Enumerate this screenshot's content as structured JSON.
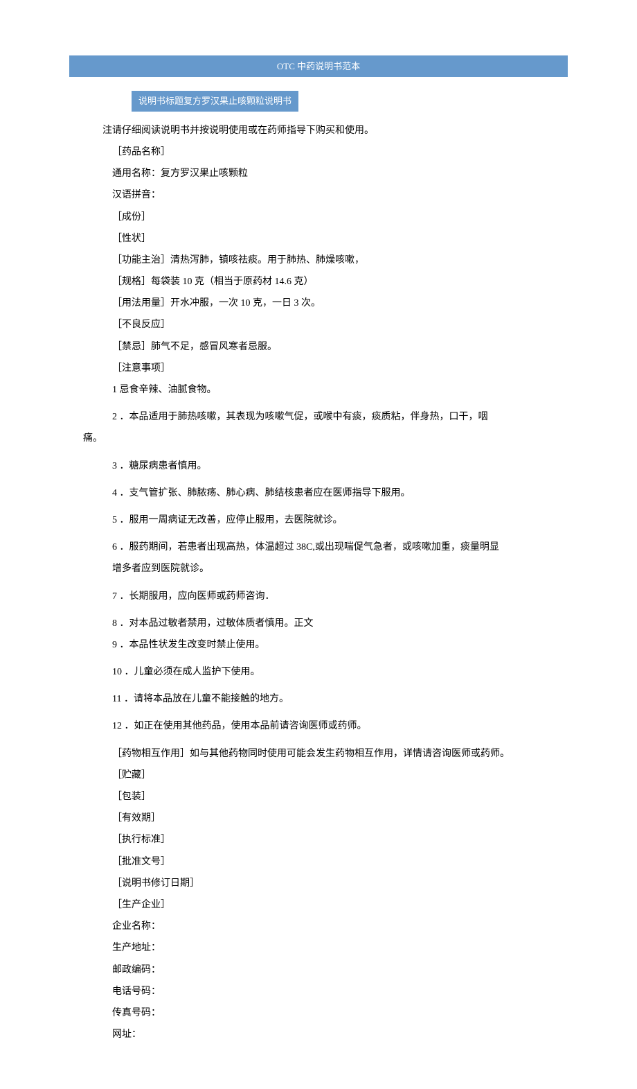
{
  "header": {
    "title": "OTC 中药说明书范本"
  },
  "subtitle": "说明书标题复方罗汉果止咳颗粒说明书",
  "intro": "注请仔细阅读说明书并按说明使用或在药师指导下购买和使用。",
  "fields": {
    "drug_name_label": "［药品名称］",
    "generic_name": "通用名称：复方罗汉果止咳颗粒",
    "pinyin": "汉语拼音：",
    "ingredients": "［成份］",
    "properties": "［性状］",
    "functions": "［功能主治］清热泻肺，镇咳祛痰。用于肺热、肺燥咳嗽，",
    "spec": "［规格］每袋装 10 克（相当于原药材 14.6 克）",
    "usage": "［用法用量］开水冲服，一次 10 克，一日 3 次。",
    "adverse": "［不良反应］",
    "contraindications": "［禁忌］肺气不足，感冒风寒者忌服。",
    "precautions_label": "［注意事项］"
  },
  "precautions": {
    "p1": "1 忌食辛辣、油腻食物。",
    "p2": "2 ．本品适用于肺热咳嗽，其表现为咳嗽气促，或喉中有痰，痰质粘，伴身热，口干，咽",
    "p2_cont": "痛。",
    "p3": "3 ．糖尿病患者慎用。",
    "p4": "4 ．支气管扩张、肺脓疡、肺心病、肺结核患者应在医师指导下服用。",
    "p5": "5 ．服用一周病证无改善，应停止服用，去医院就诊。",
    "p6": "6 ．服药期间，若患者出现高热，体温超过 38C,或出现喘促气急者，或咳嗽加重，痰量明显",
    "p6_cont": "增多者应到医院就诊。",
    "p7": "7 ．长期服用，应向医师或药师咨询．",
    "p8": "8 ．对本品过敏者禁用，过敏体质者慎用。正文",
    "p9": "9 ．本品性状发生改变时禁止使用。",
    "p10": "10 ．儿童必须在成人监护下使用。",
    "p11": "11 ．请将本品放在儿童不能接触的地方。",
    "p12": "12 ．如正在使用其他药品，使用本品前请咨询医师或药师。"
  },
  "footer_fields": {
    "interaction": "［药物相互作用］如与其他药物同时使用可能会发生药物相互作用，详情请咨询医师或药师。",
    "storage": "［贮藏］",
    "packaging": "［包装］",
    "validity": "［有效期］",
    "standard": "［执行标准］",
    "approval": "［批准文号］",
    "revision": "［说明书修订日期］",
    "manufacturer": "［生产企业］",
    "company_name": "企业名称：",
    "address": "生产地址：",
    "postal": "邮政编码：",
    "phone": "电话号码：",
    "fax": "传真号码：",
    "website": "网址："
  }
}
